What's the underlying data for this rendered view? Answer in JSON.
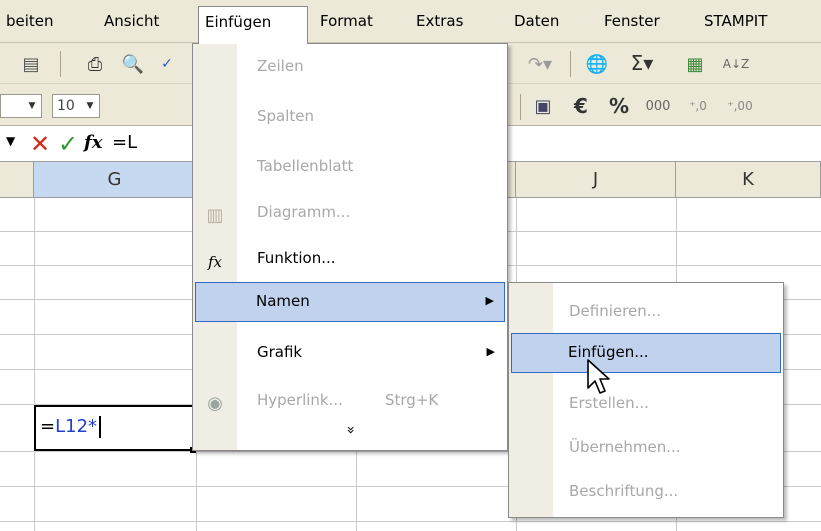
{
  "menubar": {
    "items": [
      {
        "label": "beiten"
      },
      {
        "label": "Ansicht"
      },
      {
        "label": "Einfügen"
      },
      {
        "label": "Format"
      },
      {
        "label": "Extras"
      },
      {
        "label": "Daten"
      },
      {
        "label": "Fenster"
      },
      {
        "label": "STAMPIT"
      }
    ]
  },
  "toolbar": {
    "font_size": "10",
    "icons": [
      "permission-icon",
      "print-icon",
      "print-preview-icon",
      "spelling-icon",
      "redo-icon",
      "hyperlink-icon",
      "autosum-icon",
      "insert-function-icon",
      "sort-ascending-icon",
      "merge-center-icon",
      "euro-icon",
      "percent-icon",
      "thousands-icon",
      "increase-decimal-icon",
      "decrease-decimal-icon"
    ],
    "sigma": "Σ",
    "euro": "€",
    "percent": "%",
    "thousands": "000",
    "inc_dec": "⁺,0",
    "dec_dec": "⁺,00",
    "sort": "A↓Z"
  },
  "formula_bar": {
    "cancel": "✕",
    "enter": "✓",
    "fx": "fx",
    "value": "=L"
  },
  "columns": [
    {
      "label": "G"
    },
    {
      "label": "J"
    },
    {
      "label": "K"
    }
  ],
  "active_cell": {
    "prefix": "=",
    "ref": "L12",
    "suffix": "*"
  },
  "insert_menu": {
    "items": [
      {
        "label": "Zeilen",
        "disabled": true
      },
      {
        "label": "Spalten",
        "disabled": true
      },
      {
        "label": "Tabellenblatt",
        "disabled": true
      },
      {
        "label": "Diagramm...",
        "disabled": true
      },
      {
        "label": "Funktion...",
        "disabled": false
      },
      {
        "label": "Namen",
        "disabled": false
      },
      {
        "label": "Grafik",
        "disabled": false
      },
      {
        "label": "Hyperlink...",
        "shortcut": "Strg+K",
        "disabled": true
      }
    ],
    "expand": "»"
  },
  "names_submenu": {
    "items": [
      {
        "label": "Definieren...",
        "disabled": true
      },
      {
        "label": "Einfügen...",
        "disabled": false
      },
      {
        "label": "Erstellen...",
        "disabled": true
      },
      {
        "label": "Übernehmen...",
        "disabled": true
      },
      {
        "label": "Beschriftung...",
        "disabled": true
      }
    ]
  }
}
